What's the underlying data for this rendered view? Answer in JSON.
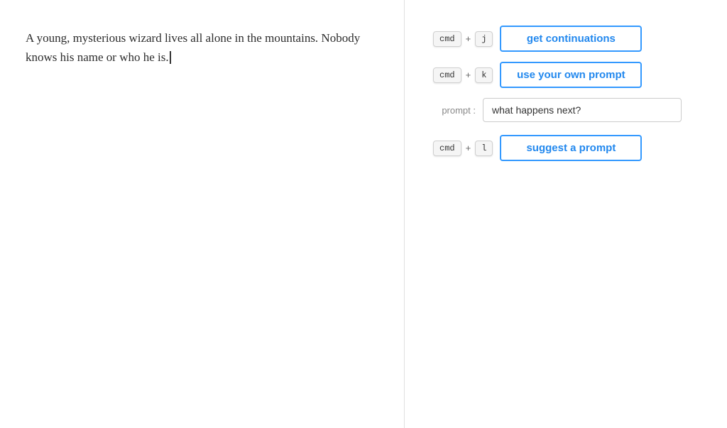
{
  "left": {
    "story_text": "A young, mysterious wizard lives all alone in the mountains. Nobody knows his name or who he is."
  },
  "right": {
    "btn1": {
      "kbd1": "cmd",
      "plus1": "+",
      "kbd2": "j",
      "label": "get continuations"
    },
    "btn2": {
      "kbd1": "cmd",
      "plus1": "+",
      "kbd2": "k",
      "label": "use your own prompt"
    },
    "prompt": {
      "label": "prompt :",
      "value": "what happens next?"
    },
    "btn3": {
      "kbd1": "cmd",
      "plus1": "+",
      "kbd2": "l",
      "label": "suggest a prompt"
    }
  }
}
